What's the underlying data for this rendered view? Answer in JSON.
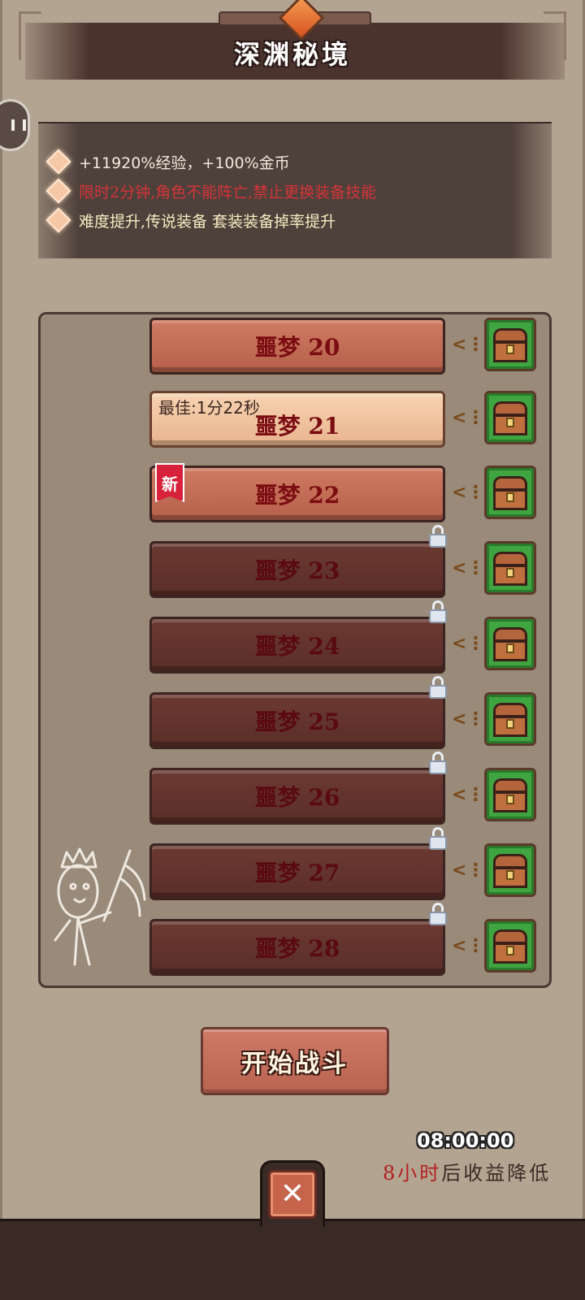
{
  "header": {
    "title": "深渊秘境"
  },
  "info": {
    "line1": "+11920%经验，+100%金币",
    "line2": "限时2分钟,角色不能阵亡,禁止更换装备技能",
    "line3": "难度提升,传说装备 套装装备掉率提升"
  },
  "levels": [
    {
      "label": "噩梦 20",
      "state": "open"
    },
    {
      "label": "噩梦 21",
      "state": "cleared",
      "best_time": "最佳:1分22秒"
    },
    {
      "label": "噩梦 22",
      "state": "open",
      "badge": "新"
    },
    {
      "label": "噩梦 23",
      "state": "locked"
    },
    {
      "label": "噩梦 24",
      "state": "locked"
    },
    {
      "label": "噩梦 25",
      "state": "locked"
    },
    {
      "label": "噩梦 26",
      "state": "locked"
    },
    {
      "label": "噩梦 27",
      "state": "locked"
    },
    {
      "label": "噩梦 28",
      "state": "locked"
    }
  ],
  "start_button": {
    "label": "开始战斗"
  },
  "timer": {
    "value": "08:00:00",
    "hours_highlight": "8小时",
    "note": "后收益降低"
  },
  "close_button": {
    "label": "✕"
  },
  "colors": {
    "panel": "#b3a491",
    "accent_red": "#b32020",
    "chest_green": "#3fa540"
  },
  "icons": [
    "gem-icon",
    "sparkle-icon",
    "lock-icon",
    "chest-icon",
    "connector-icon",
    "close-icon",
    "pause-icon"
  ]
}
